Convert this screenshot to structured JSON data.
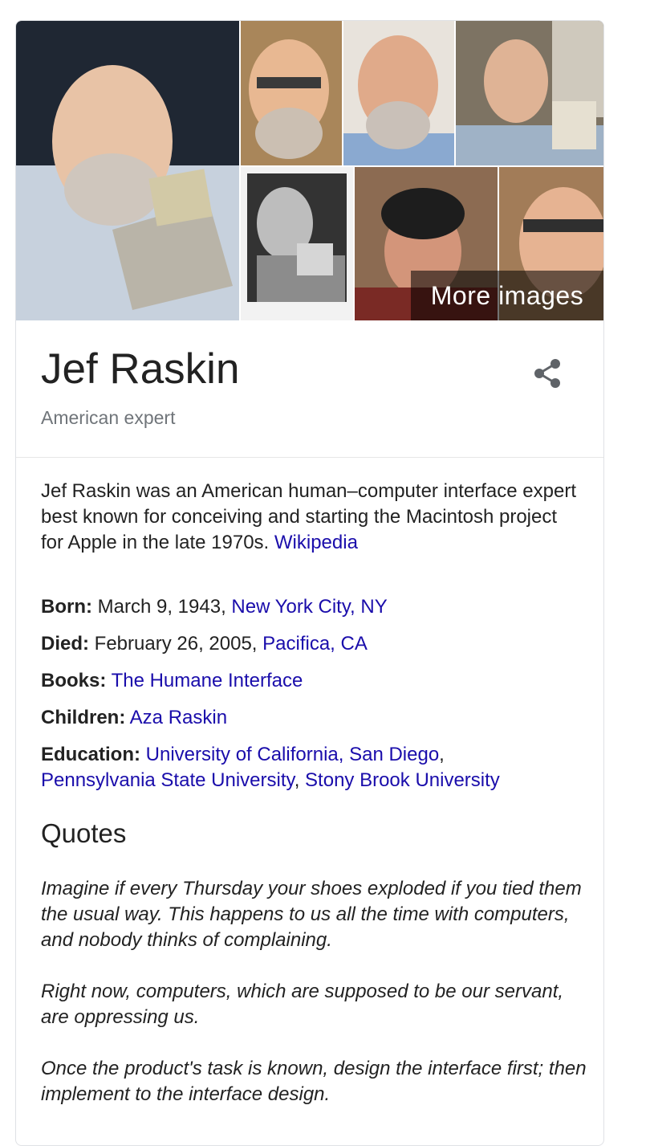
{
  "images": {
    "more_label": "More images"
  },
  "header": {
    "title": "Jef Raskin",
    "subtitle": "American expert"
  },
  "description": {
    "text": "Jef Raskin was an American human–computer interface expert best known for conceiving and starting the Macintosh project for Apple in the late 1970s. ",
    "source": "Wikipedia"
  },
  "facts": {
    "born": {
      "label": "Born:",
      "text": " March 9, 1943, ",
      "link": "New York City, NY"
    },
    "died": {
      "label": "Died:",
      "text": " February 26, 2005, ",
      "link": "Pacifica, CA"
    },
    "books": {
      "label": "Books:",
      "link": "The Humane Interface"
    },
    "children": {
      "label": "Children:",
      "link": "Aza Raskin"
    },
    "education": {
      "label": "Education:",
      "links": [
        "University of California, San Diego",
        "Pennsylvania State University",
        "Stony Brook University"
      ]
    }
  },
  "quotes": {
    "heading": "Quotes",
    "items": [
      "Imagine if every Thursday your shoes exploded if you tied them the usual way. This happens to us all the time with computers, and nobody thinks of complaining.",
      "Right now, computers, which are supposed to be our servant, are oppressing us.",
      "Once the product's task is known, design the interface first; then implement to the interface design."
    ]
  },
  "colors": {
    "link": "#1a0dab",
    "subtitle": "#70757a",
    "border": "#dfe1e5"
  }
}
